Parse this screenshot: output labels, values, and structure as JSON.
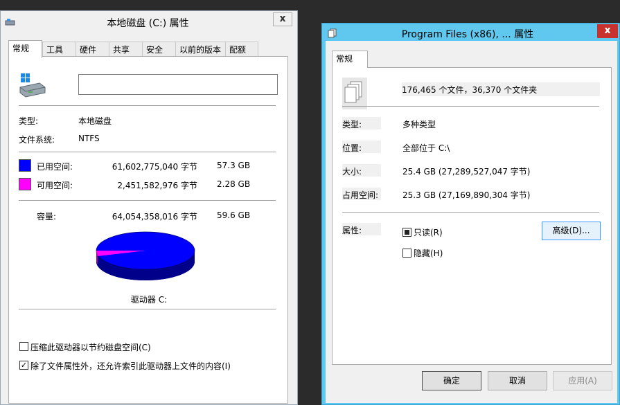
{
  "left": {
    "title": "本地磁盘 (C:) 属性",
    "close": "x",
    "tabs": [
      "常规",
      "工具",
      "硬件",
      "共享",
      "安全",
      "以前的版本",
      "配额"
    ],
    "name_value": "",
    "type_label": "类型:",
    "type_value": "本地磁盘",
    "fs_label": "文件系统:",
    "fs_value": "NTFS",
    "used_label": "已用空间:",
    "used_bytes": "61,602,775,040 字节",
    "used_gb": "57.3 GB",
    "free_label": "可用空间:",
    "free_bytes": "2,451,582,976 字节",
    "free_gb": "2.28 GB",
    "capacity_label": "容量:",
    "capacity_bytes": "64,054,358,016 字节",
    "capacity_gb": "59.6 GB",
    "drive_label": "驱动器 C:",
    "compress_label": "压缩此驱动器以节约磁盘空间(C)",
    "compress_checked": false,
    "index_label": "除了文件属性外，还允许索引此驱动器上文件的内容(I)",
    "index_checked": true,
    "used_fraction": 0.962,
    "colors": {
      "used": "#0000ff",
      "free": "#ff00ff"
    }
  },
  "right": {
    "title": "Program Files (x86), ... 属性",
    "close": "x",
    "tab": "常规",
    "summary": "176,465 个文件，36,370 个文件夹",
    "type_label": "类型:",
    "type_value": "多种类型",
    "location_label": "位置:",
    "location_value": "全部位于 C:\\",
    "size_label": "大小:",
    "size_value": "25.4 GB (27,289,527,047 字节)",
    "disk_label": "占用空间:",
    "disk_value": "25.3 GB (27,169,890,304 字节)",
    "attr_label": "属性:",
    "readonly_label": "只读(R)",
    "hidden_label": "隐藏(H)",
    "advanced_button": "高级(D)...",
    "ok_button": "确定",
    "cancel_button": "取消",
    "apply_button": "应用(A)"
  }
}
